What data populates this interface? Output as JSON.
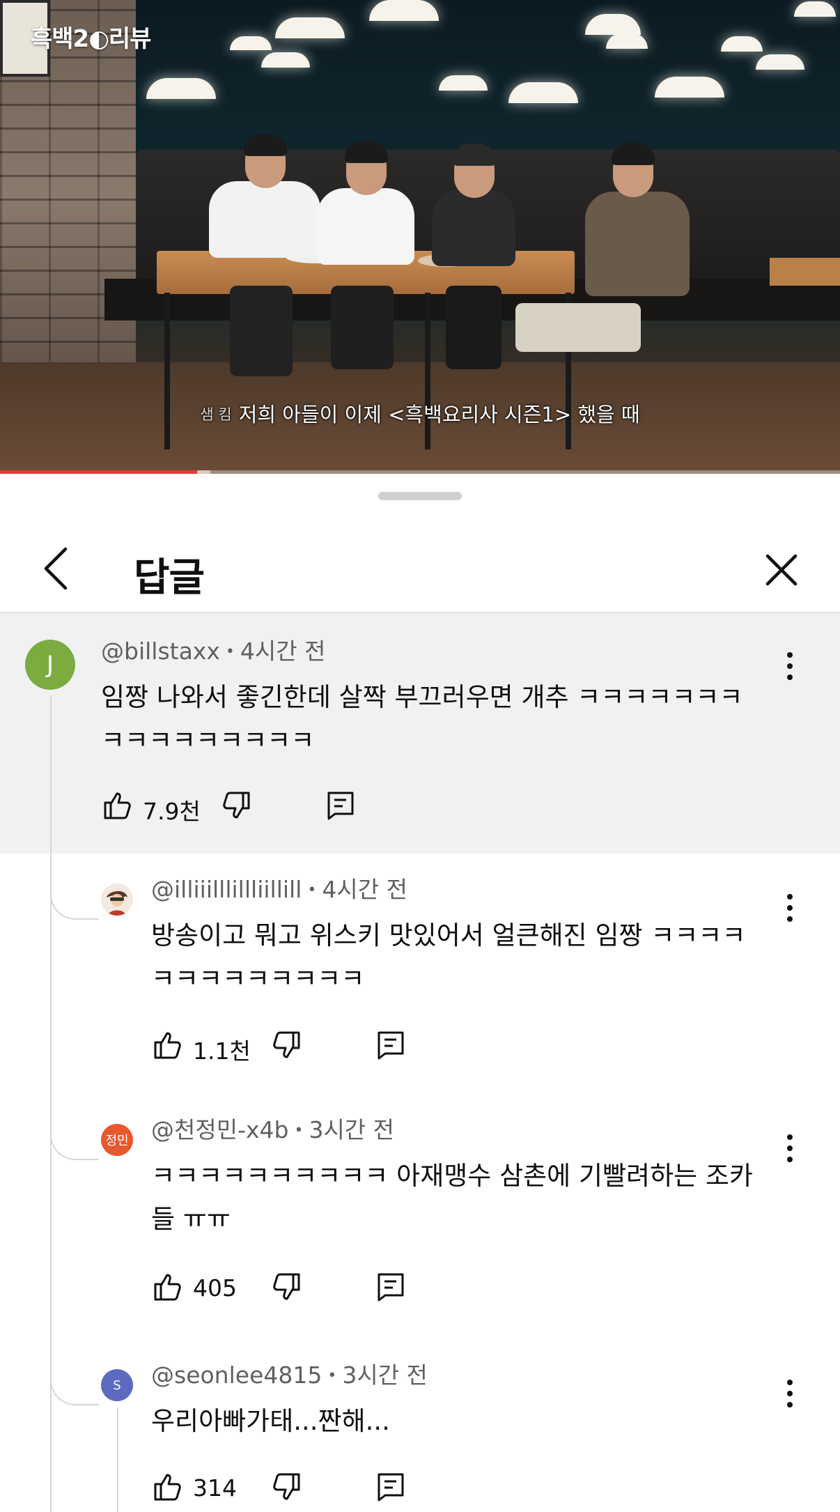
{
  "video": {
    "watermark": "흑백2◐리뷰",
    "subtitle_speaker": "샘 킴",
    "subtitle_text": "저희 아들이 이제 <흑백요리사 시즌1> 했을 때",
    "progress_played_pct": 23.5,
    "progress_buffered_pct": 25.0
  },
  "panel": {
    "title": "답글",
    "back_icon": "chevron-left-icon",
    "close_icon": "close-icon"
  },
  "parent": {
    "avatar_letter": "J",
    "avatar_color": "#7cab40",
    "username": "@billstaxx",
    "time": "4시간 전",
    "text_line1": "임짱 나와서 좋긴한데 살짝 부끄러우면 개추 ㅋㅋㅋㅋㅋㅋㅋ",
    "text_line2": "ㅋㅋㅋㅋㅋㅋㅋㅋㅋ",
    "likes": "7.9천"
  },
  "replies": [
    {
      "avatar_letter": "",
      "avatar_color": "#f3e9e0",
      "username": "@illiiilllillliillill",
      "time": "4시간 전",
      "text_line1": "방송이고 뭐고 위스키 맛있어서 얼큰해진 임짱 ㅋㅋㅋㅋ",
      "text_line2": "ㅋㅋㅋㅋㅋㅋㅋㅋㅋ",
      "likes": "1.1천"
    },
    {
      "avatar_letter": "정민",
      "avatar_color": "#e8572e",
      "username": "@천정민-x4b",
      "time": "3시간 전",
      "text_line1": "ㅋㅋㅋㅋㅋㅋㅋㅋㅋㅋ 아재맹수 삼촌에 기빨려하는 조카",
      "text_line2": "들 ㅠㅠ",
      "likes": "405"
    },
    {
      "avatar_letter": "S",
      "avatar_color": "#5c6bc0",
      "username": "@seonlee4815",
      "time": "3시간 전",
      "text_line1": "우리아빠가태...짠해...",
      "text_line2": "",
      "likes": "314"
    }
  ]
}
